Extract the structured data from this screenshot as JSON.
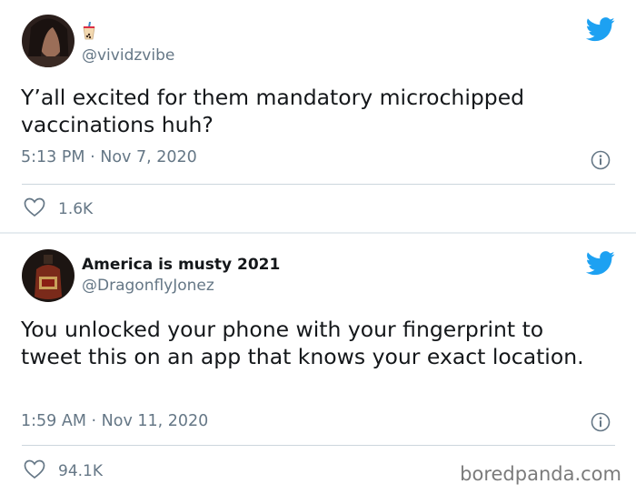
{
  "tweets": [
    {
      "display_name": "",
      "handle": "@vividzvibe",
      "handle_emoji": "bubble-tea-icon",
      "text": "Y’all excited for them mandatory microchipped vaccinations huh?",
      "time": "5:13 PM",
      "date": "Nov 7, 2020",
      "likes": "1.6K"
    },
    {
      "display_name": "America is musty 2021",
      "handle": "@DragonflyJonez",
      "text": "You unlocked your phone with your fingerprint to tweet this on an app that knows your exact location.",
      "time": "1:59 AM",
      "date": "Nov 11, 2020",
      "likes": "94.1K"
    }
  ],
  "separator": "·",
  "watermark": "boredpanda.com",
  "colors": {
    "twitter_blue": "#1da1f2",
    "secondary_text": "#657786",
    "primary_text": "#14171a"
  },
  "icons": [
    "twitter-bird-icon",
    "info-icon",
    "heart-icon",
    "bubble-tea-icon"
  ]
}
